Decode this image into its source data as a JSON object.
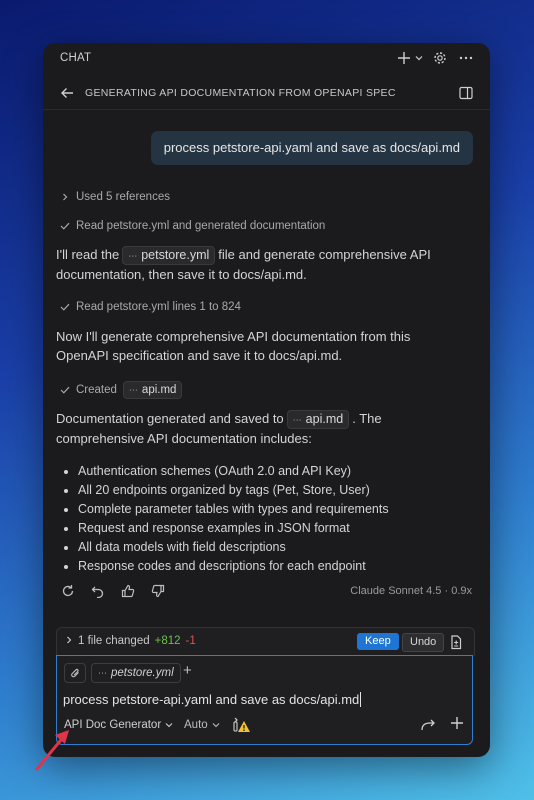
{
  "window": {
    "title": "CHAT"
  },
  "header": {
    "title": "GENERATING API DOCUMENTATION FROM OPENAPI SPEC"
  },
  "user_message": "process petstore-api.yaml and save as docs/api.md",
  "steps": {
    "references": "Used 5 references",
    "read_generated": "Read petstore.yml and generated documentation",
    "read_lines": "Read petstore.yml lines 1 to 824",
    "created_prefix": "Created",
    "created_file": "api.md"
  },
  "para1": {
    "before": "I'll read the",
    "file": "petstore.yml",
    "after": "file and generate comprehensive API documentation, then save it to docs/api.md."
  },
  "para2": "Now I'll generate comprehensive API documentation from this OpenAPI specification and save it to docs/api.md.",
  "para3": {
    "before": "Documentation generated and saved to",
    "file": "api.md",
    "after": ". The comprehensive API documentation includes:"
  },
  "bullets": [
    "Authentication schemes (OAuth 2.0 and API Key)",
    "All 20 endpoints organized by tags (Pet, Store, User)",
    "Complete parameter tables with types and requirements",
    "Request and response examples in JSON format",
    "All data models with field descriptions",
    "Response codes and descriptions for each endpoint"
  ],
  "model_info": "Claude Sonnet 4.5 · 0.9x",
  "changes": {
    "summary": "1 file changed",
    "added": "+812",
    "removed": "-1",
    "keep_label": "Keep",
    "undo_label": "Undo"
  },
  "input": {
    "context_file": "petstore.yml",
    "text": "process petstore-api.yaml and save as docs/api.md",
    "agent": "API Doc Generator",
    "model": "Auto"
  },
  "colors": {
    "accent": "#1e75d4",
    "added": "#6cc04a",
    "removed": "#e05050",
    "annotation_arrow": "#e0344a"
  }
}
